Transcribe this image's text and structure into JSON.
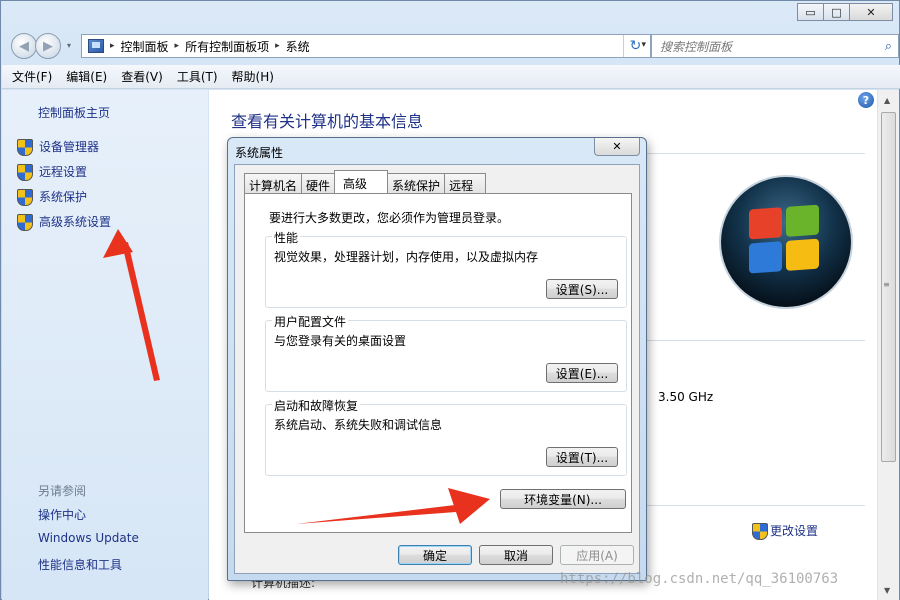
{
  "window": {
    "minimize": "▭",
    "maximize": "□",
    "close": "✕"
  },
  "nav": {
    "back": "◀",
    "forward": "▶",
    "dropdown": "▾",
    "breadcrumb": [
      "控制面板",
      "所有控制面板项",
      "系统"
    ],
    "breadcrumb_sep": "▸",
    "refresh": "↻",
    "search_placeholder": "搜索控制面板",
    "search_icon": "⌕"
  },
  "menubar": [
    "文件(F)",
    "编辑(E)",
    "查看(V)",
    "工具(T)",
    "帮助(H)"
  ],
  "sidebar": {
    "home": "控制面板主页",
    "items": [
      {
        "label": "设备管理器",
        "icon": "uac-shield-icon"
      },
      {
        "label": "远程设置",
        "icon": "uac-shield-icon"
      },
      {
        "label": "系统保护",
        "icon": "uac-shield-icon"
      },
      {
        "label": "高级系统设置",
        "icon": "uac-shield-icon"
      }
    ],
    "see_also": "另请参阅",
    "links": [
      "操作中心",
      "Windows Update",
      "性能信息和工具"
    ]
  },
  "main": {
    "title": "查看有关计算机的基本信息",
    "cpu_speed": "3.50 GHz",
    "change_settings": "更改设置",
    "computer_name_label": "计算机描述:",
    "help": "?"
  },
  "dialog": {
    "title": "系统属性",
    "close": "✕",
    "tabs": [
      "计算机名",
      "硬件",
      "高级",
      "系统保护",
      "远程"
    ],
    "active_tab": "高级",
    "admin_note": "要进行大多数更改，您必须作为管理员登录。",
    "groups": [
      {
        "label": "性能",
        "desc": "视觉效果，处理器计划，内存使用，以及虚拟内存",
        "button": "设置(S)..."
      },
      {
        "label": "用户配置文件",
        "desc": "与您登录有关的桌面设置",
        "button": "设置(E)..."
      },
      {
        "label": "启动和故障恢复",
        "desc": "系统启动、系统失败和调试信息",
        "button": "设置(T)..."
      }
    ],
    "env_button": "环境变量(N)...",
    "ok": "确定",
    "cancel": "取消",
    "apply": "应用(A)"
  },
  "watermark": "https://blog.csdn.net/qq_36100763",
  "colors": {
    "link": "#1e3287",
    "annotation_arrow": "#e8321e"
  }
}
